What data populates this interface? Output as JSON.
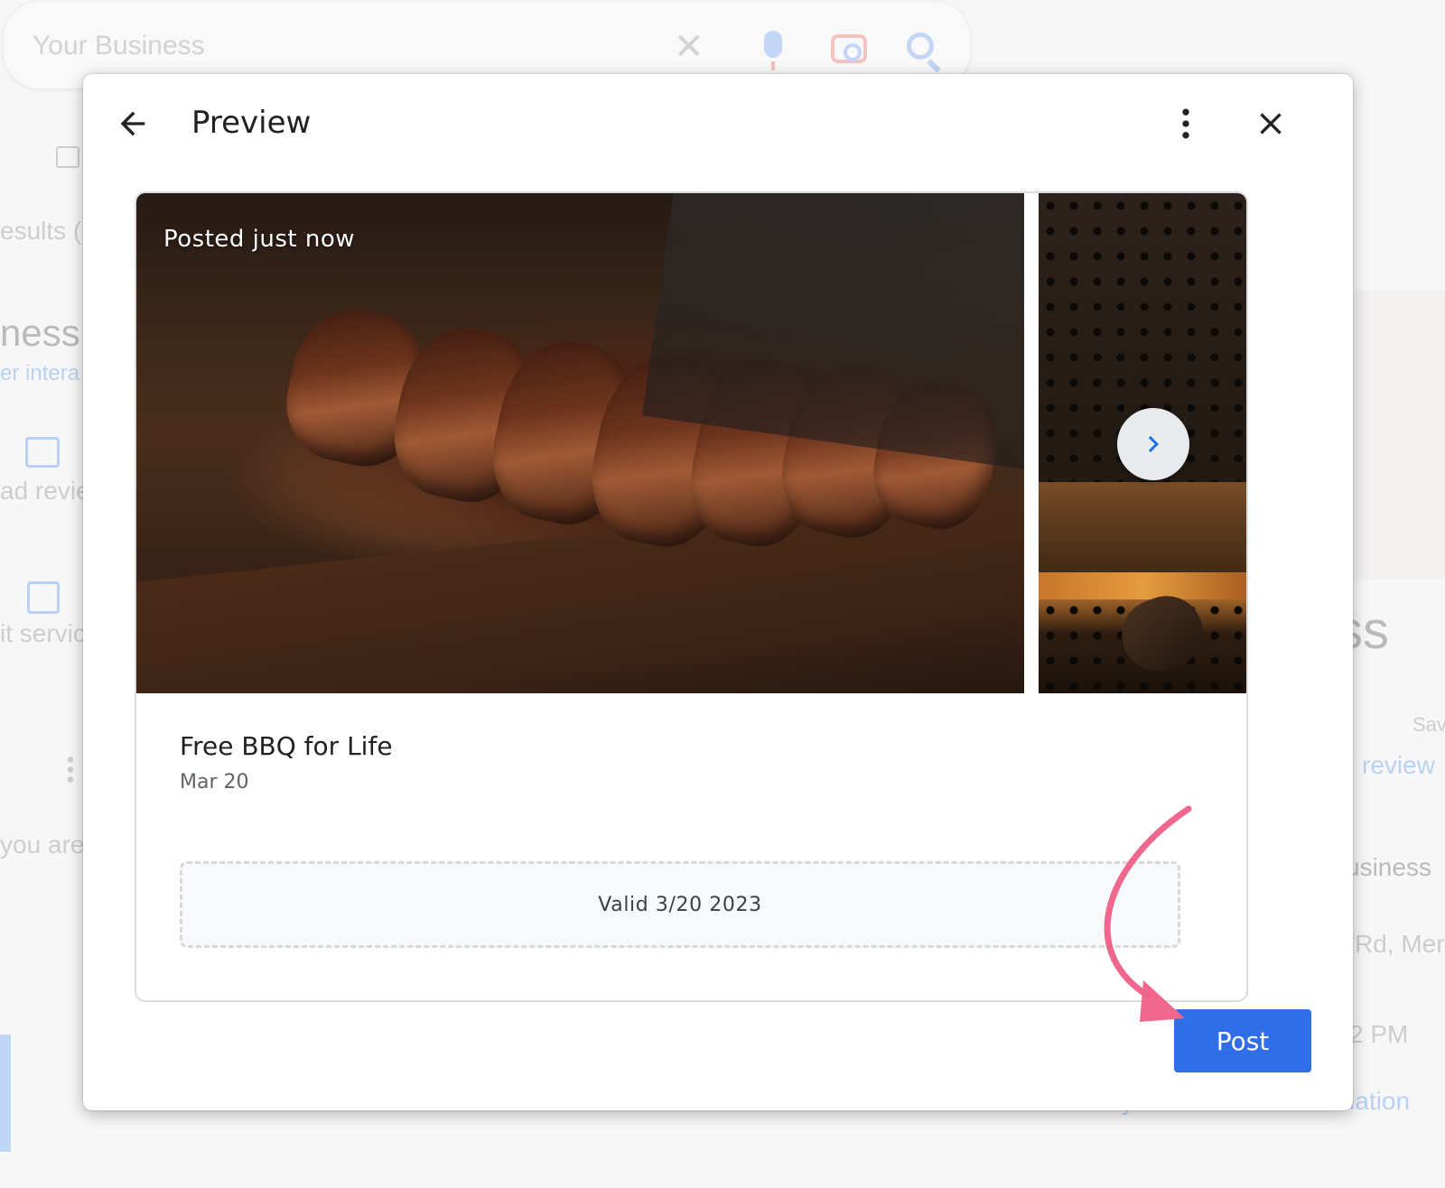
{
  "background": {
    "search_text": "Your Business",
    "left_fragments": [
      "esults (",
      "ness",
      "er intera",
      "ad revie",
      "it servic",
      "you are"
    ],
    "right_fragments": [
      "ss",
      "Sav",
      "review",
      "usiness",
      "Rd, Mer",
      "2 PM",
      "Edit your business information"
    ]
  },
  "modal": {
    "title": "Preview",
    "post": {
      "posted_label": "Posted just now",
      "title": "Free BBQ for Life",
      "date": "Mar 20",
      "offer_valid": "Valid 3/20 2023"
    },
    "post_button": "Post"
  },
  "colors": {
    "primary_button": "#2f6ee6",
    "annotation_arrow": "#f0668c",
    "next_chevron": "#1a73e8"
  },
  "icons": {
    "back": "arrow-left-icon",
    "more": "more-vert-icon",
    "close": "close-icon",
    "next": "chevron-right-icon"
  }
}
